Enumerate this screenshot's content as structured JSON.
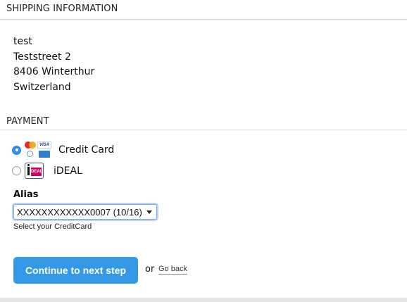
{
  "shipping": {
    "title": "SHIPPING INFORMATION",
    "address": [
      "test",
      "Teststreet 2",
      "8406 Winterthur",
      "Switzerland"
    ]
  },
  "payment": {
    "title": "PAYMENT",
    "methods": [
      {
        "label": "Credit Card",
        "selected": true,
        "icon": "credit-card-logos-icon"
      },
      {
        "label": "iDEAL",
        "selected": false,
        "icon": "ideal-logo-icon"
      }
    ],
    "alias": {
      "label": "Alias",
      "selected_value": "XXXXXXXXXXXX0007 (10/16)",
      "hint": "Select your CreditCard"
    }
  },
  "actions": {
    "continue_label": "Continue to next step",
    "or_text": "or",
    "go_back_label": "Go back"
  },
  "colors": {
    "accent": "#3399e6",
    "radio_checked": "#3b8ee6",
    "divider": "#d9d9d9"
  }
}
